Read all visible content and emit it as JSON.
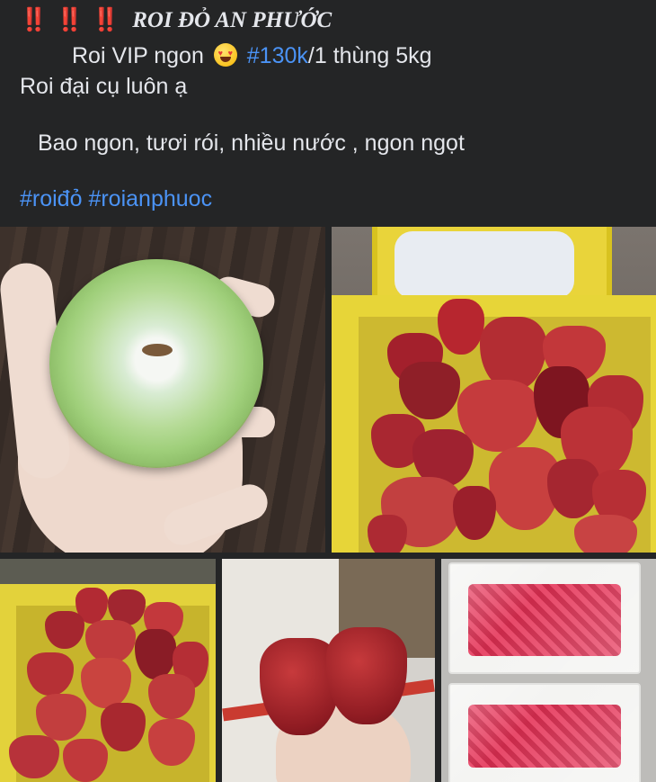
{
  "post": {
    "bangs": "‼️ ‼️ ‼️",
    "title": "ROI ĐỎ AN PHƯỚC",
    "line2_pre": "Roi VIP ngon",
    "emoji": "heart-eyes-emoji",
    "price_tag": "#130k",
    "line2_post": "/1 thùng 5kg",
    "line3": "Roi đại cụ luôn ạ",
    "line4": "Bao ngon, tươi rói, nhiều nước , ngon ngọt",
    "hashtags": [
      "#roiđỏ",
      "#roianphuoc"
    ]
  },
  "colors": {
    "background": "#242526",
    "text": "#e4e6eb",
    "hashtag": "#4b93f5",
    "alert": "#e0245e"
  },
  "photos": [
    {
      "name": "photo-cut-rose-apple"
    },
    {
      "name": "photo-basket-rose-apples"
    },
    {
      "name": "photo-basket-rose-apples-2"
    },
    {
      "name": "photo-hand-holding-rose-apples"
    },
    {
      "name": "photo-packed-rose-apple-trays"
    }
  ]
}
